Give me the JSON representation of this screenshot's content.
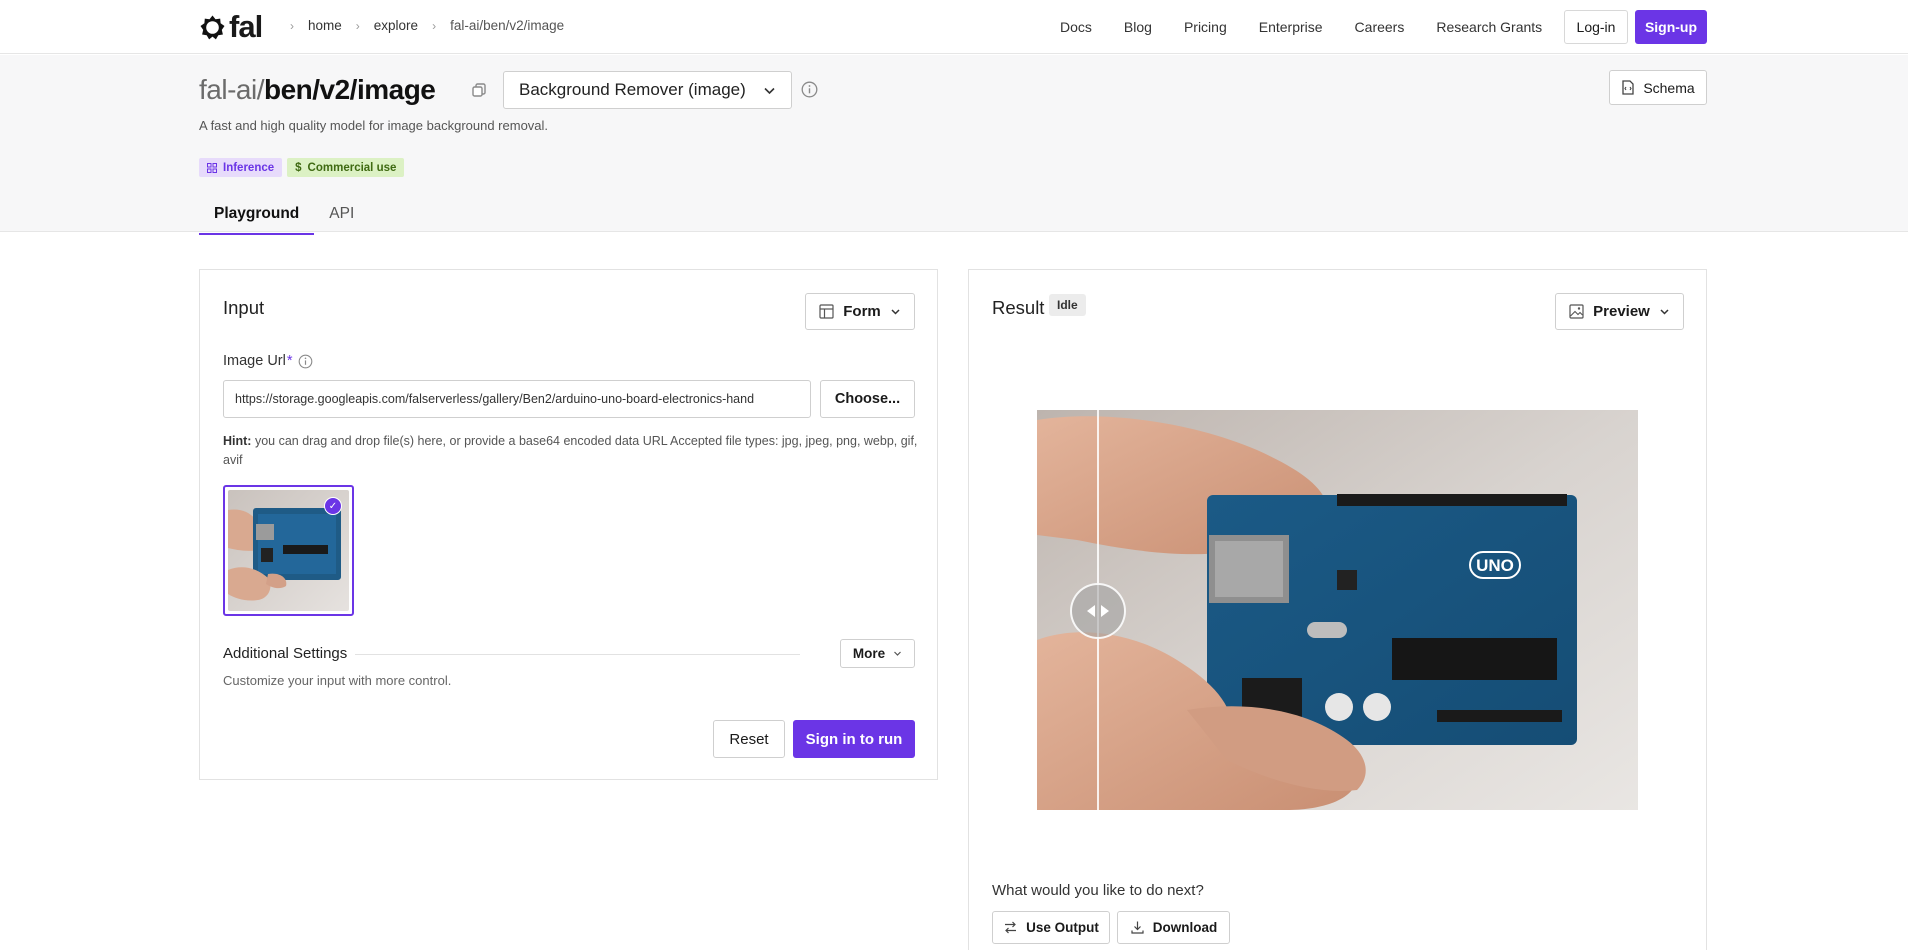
{
  "nav": {
    "logo_text": "fal",
    "breadcrumbs": [
      "home",
      "explore",
      "fal-ai/ben/v2/image"
    ],
    "links": [
      "Docs",
      "Blog",
      "Pricing",
      "Enterprise",
      "Careers",
      "Research Grants"
    ],
    "login_label": "Log-in",
    "signup_label": "Sign-up"
  },
  "model": {
    "namespace": "fal-ai/",
    "name": "ben/v2/image",
    "selector_value": "Background Remover (image)",
    "description": "A fast and high quality model for image background removal.",
    "schema_label": "Schema",
    "badges": [
      "Inference",
      "Commercial use"
    ]
  },
  "tabs": [
    "Playground",
    "API"
  ],
  "input": {
    "title": "Input",
    "mode_label": "Form",
    "image_url_label": "Image Url",
    "required_mark": "*",
    "image_url_value": "https://storage.googleapis.com/falserverless/gallery/Ben2/arduino-uno-board-electronics-hand",
    "choose_label": "Choose...",
    "hint_label": "Hint:",
    "hint_text": " you can drag and drop file(s) here, or provide a base64 encoded data URL Accepted file types: jpg, jpeg, png, webp, gif, avif",
    "additional_settings_title": "Additional Settings",
    "more_label": "More",
    "additional_settings_desc": "Customize your input with more control.",
    "reset_label": "Reset",
    "run_label": "Sign in to run"
  },
  "result": {
    "title": "Result",
    "status": "Idle",
    "view_label": "Preview",
    "next_prompt": "What would you like to do next?",
    "use_output_label": "Use Output",
    "download_label": "Download",
    "board_text": "UNO"
  },
  "colors": {
    "accent": "#6b35e6",
    "badge_inference_bg": "#e7dbfb",
    "badge_commercial_bg": "#dcf1c4"
  },
  "icons": [
    "logo-icon",
    "chevron-right-icon",
    "copy-icon",
    "chevron-down-icon",
    "info-icon",
    "schema-icon",
    "grid-icon",
    "dollar-icon",
    "form-icon",
    "check-icon",
    "image-icon",
    "slider-arrows-icon",
    "arrows-swap-icon",
    "download-icon"
  ]
}
